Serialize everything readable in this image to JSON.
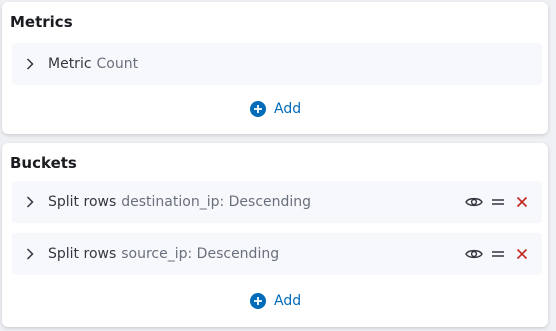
{
  "metrics": {
    "title": "Metrics",
    "rows": [
      {
        "label": "Metric",
        "desc": "Count"
      }
    ],
    "add_label": "Add"
  },
  "buckets": {
    "title": "Buckets",
    "rows": [
      {
        "label": "Split rows",
        "desc": "destination_ip: Descending"
      },
      {
        "label": "Split rows",
        "desc": "source_ip: Descending"
      }
    ],
    "add_label": "Add"
  },
  "icons": {
    "expand": "chevron-right-icon",
    "toggle": "eye-icon",
    "drag": "drag-handle-icon",
    "remove": "close-icon",
    "add": "plus-circle-icon"
  },
  "colors": {
    "accent": "#006bb8",
    "danger": "#bd271e",
    "row_background": "#f7f8fc"
  }
}
